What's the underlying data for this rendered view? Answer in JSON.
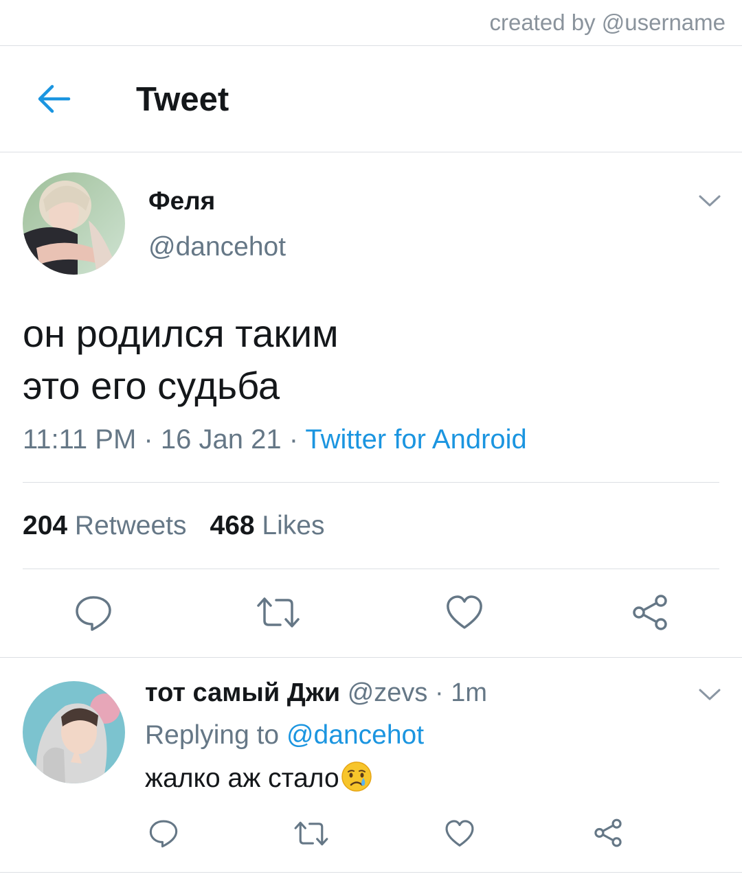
{
  "credit": "created by @username",
  "header": {
    "title": "Tweet",
    "back_icon": "arrow-left-icon"
  },
  "colors": {
    "accent": "#1b95e0",
    "muted": "#657786",
    "text": "#14171a",
    "divider": "#dcdfe3"
  },
  "tweet": {
    "display_name": "Феля",
    "handle": "@dancehot",
    "text_line1": "он родился таким",
    "text_line2": "это его судьба",
    "time": "11:11 PM",
    "date": "16 Jan 21",
    "source": "Twitter for Android",
    "retweets_count": "204",
    "retweets_label": "Retweets",
    "likes_count": "468",
    "likes_label": "Likes",
    "actions": [
      "reply-icon",
      "retweet-icon",
      "like-icon",
      "share-icon"
    ]
  },
  "reply": {
    "display_name": "тот самый Джи",
    "handle": "@zevs",
    "time": "1m",
    "replying_prefix": "Replying to",
    "replying_to": "@dancehot",
    "text": "жалко аж стало",
    "emoji": "crying-face-emoji",
    "actions": [
      "reply-icon",
      "retweet-icon",
      "like-icon",
      "share-icon"
    ]
  }
}
